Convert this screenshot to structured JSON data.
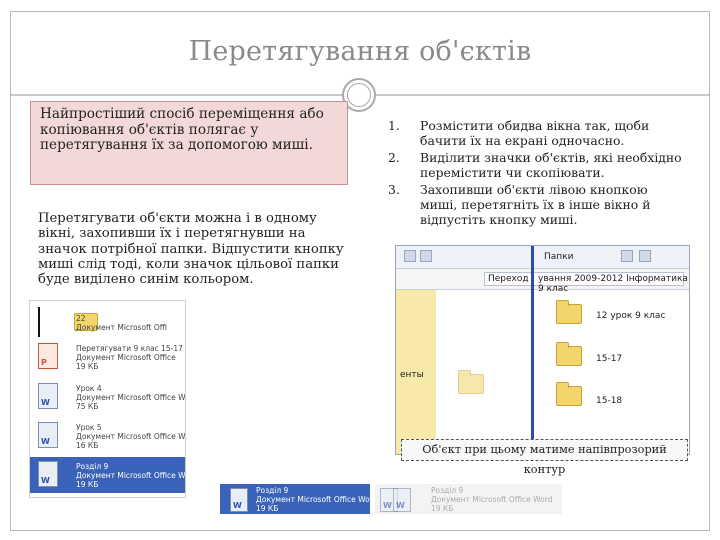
{
  "slide": {
    "title": "Перетягування об'єктів",
    "intro_text": "Найпростіший спосіб переміщення або копіювання об'єктів полягає у перетягування їх за допомогою миші.",
    "paragraph": "Перетягувати об'єкти можна і в одному вікні, захопивши їх і перетягнувши на значок потрібної папки. Відпустити кнопку миші слід тоді, коли значок цільової папки буде виділено синім кольором.",
    "steps": [
      {
        "num": "1.",
        "text": "Розмістити обидва вікна так, щоби бачити їх на екрані одночасно."
      },
      {
        "num": "2.",
        "text": "Виділити значки об'єктів, які необхідно перемістити чи скопіювати."
      },
      {
        "num": "3.",
        "text": "Захопивши об'єкти лівою кнопкою миші, перетягніть їх в інше вікно й відпустіть кнопку миші."
      }
    ],
    "caption": "Об'єкт при цьому матиме напівпрозорий контур"
  },
  "explorer": {
    "addr_left": "Переход",
    "addr_right": "ування 2009-2012 Інформатика 9 клас",
    "toolbar_left": "Папки",
    "left_label": "енты",
    "folders": [
      "12 урок 9 клас",
      "15-17",
      "15-18"
    ]
  },
  "file_list": [
    {
      "name": "22",
      "line2": "Документ Microsoft Offi",
      "line3": "",
      "type": "word",
      "selected": false
    },
    {
      "name": "Перетягувати 9 клас 15-17",
      "line2": "Документ Microsoft Office",
      "line3": "19 КБ",
      "type": "ppt",
      "selected": false
    },
    {
      "name": "Урок 4",
      "line2": "Документ Microsoft Office Word",
      "line3": "75 КБ",
      "type": "word",
      "selected": false
    },
    {
      "name": "Урок 5",
      "line2": "Документ Microsoft Office Word",
      "line3": "16 КБ",
      "type": "word",
      "selected": false
    },
    {
      "name": "Розділ 9",
      "line2": "Документ Microsoft Office Word",
      "line3": "19 КБ",
      "type": "word",
      "selected": true
    }
  ],
  "drag_strip": {
    "selected": {
      "name": "Розділ 9",
      "line2": "Документ Microsoft Office Word",
      "line3": "19 КБ"
    },
    "ghost": {
      "name": "Розділ 9",
      "line2": "Документ Microsoft Office Word",
      "line3": "19 КБ"
    }
  },
  "colors": {
    "pink_box": "#f2d9d7",
    "selection_blue": "#3a62b8",
    "folder_yellow": "#f3d56b"
  }
}
